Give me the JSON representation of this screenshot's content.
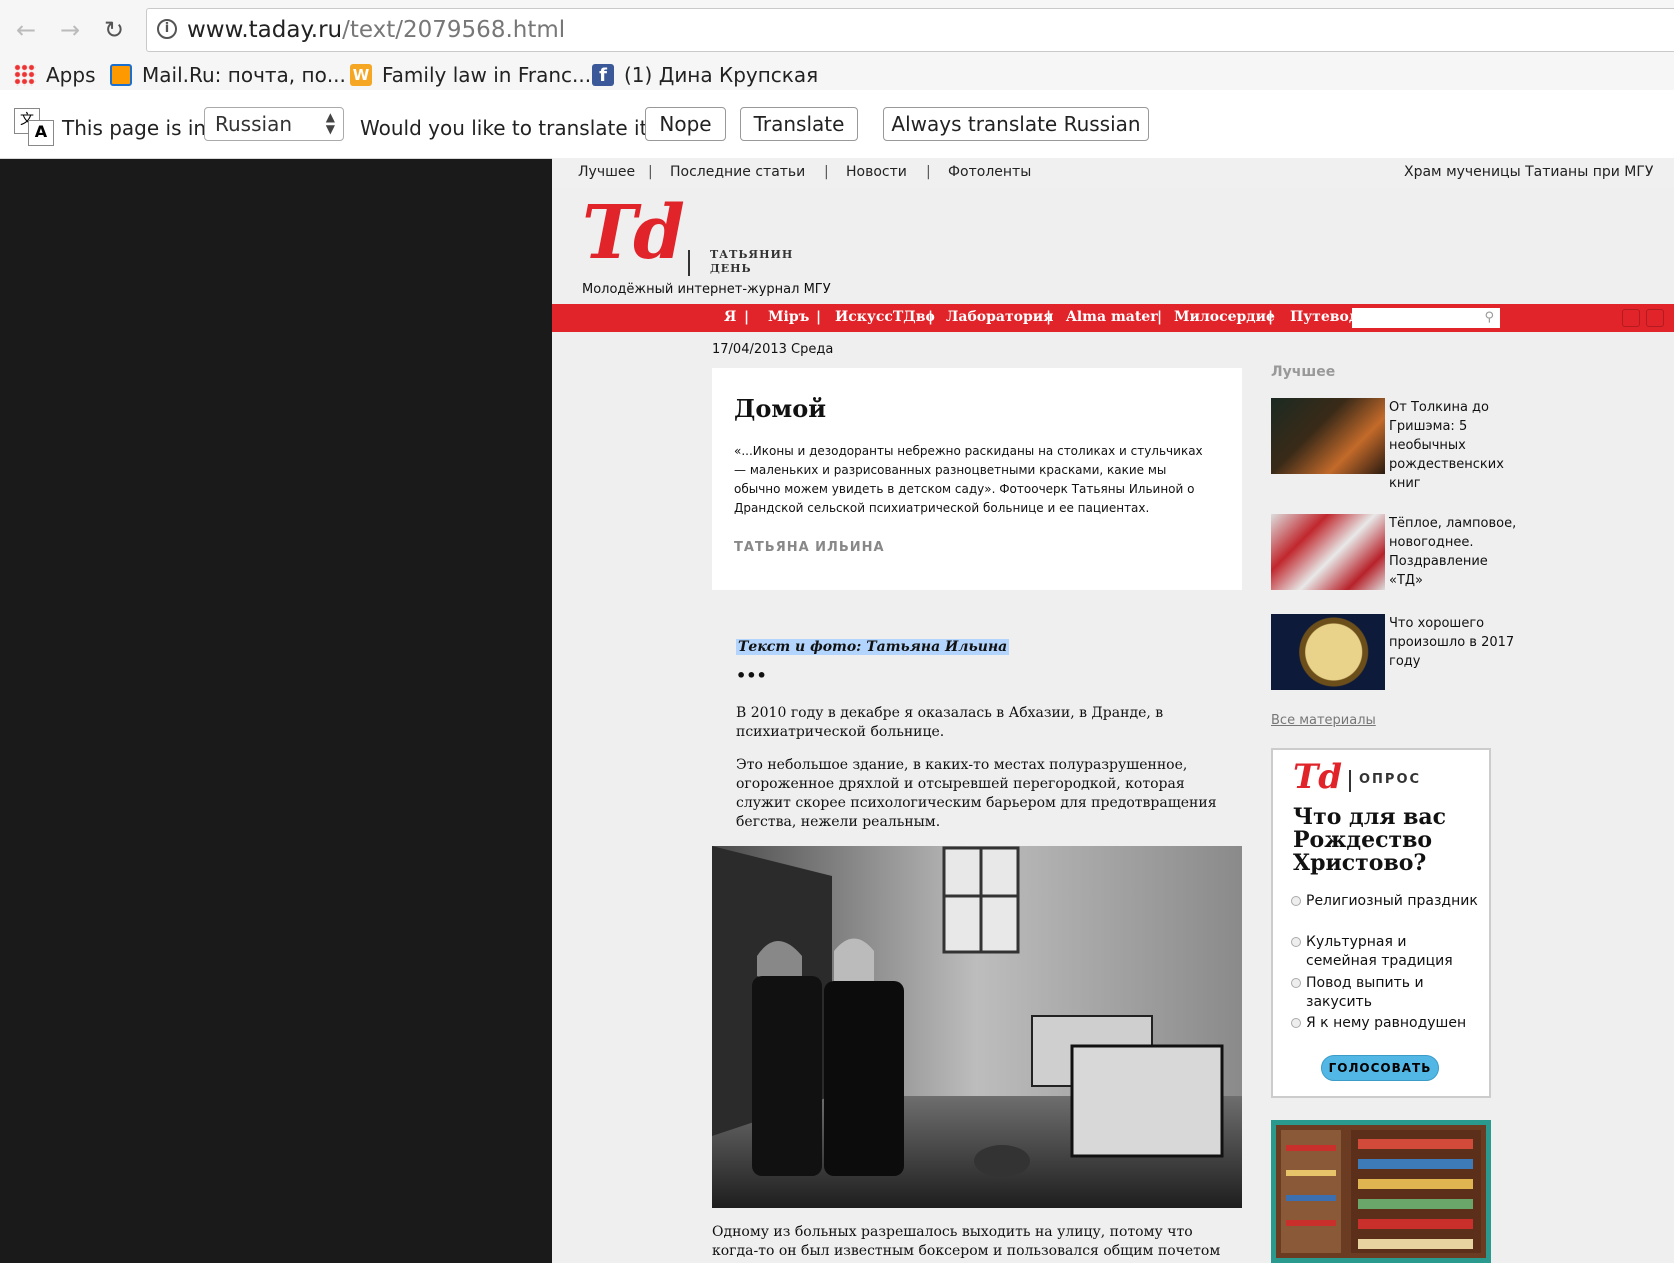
{
  "browser": {
    "url_host": "www.taday.ru",
    "url_path": "/text/2079568.html",
    "bookmarks": [
      {
        "label": "Apps"
      },
      {
        "label": "Mail.Ru: почта, по..."
      },
      {
        "label": "Family law in Franc..."
      },
      {
        "label": "(1) Дина Крупская"
      }
    ],
    "translate": {
      "page_is_in": "This page is in",
      "language": "Russian",
      "question": "Would you like to translate it?",
      "nope": "Nope",
      "translate": "Translate",
      "always": "Always translate Russian"
    }
  },
  "site": {
    "topnav": [
      "Лучшее",
      "Последние статьи",
      "Новости",
      "Фотоленты"
    ],
    "topnav_right": "Храм мученицы Татианы при МГУ",
    "logo": "Td",
    "logo_name_line1": "ТАТЬЯНИН",
    "logo_name_line2": "ДЕНЬ",
    "tagline": "Молодёжный интернет-журнал МГУ",
    "mainnav": [
      "Я",
      "Міръ",
      "ИскуссТДво",
      "Лаборатория",
      "Alma mater",
      "Милосердие",
      "Путеводи"
    ]
  },
  "article": {
    "date": "17/04/2013 Среда",
    "title": "Домой",
    "lead": "«...Иконы и дезодоранты небрежно раскиданы на столиках и стульчиках — маленьких и разрисованных разноцветными красками, какие мы обычно можем увидеть в детском саду». Фотоочерк Татьяны Ильиной о Драндской сельской психиатрической больнице и ее пациентах.",
    "author": "ТАТЬЯНА ИЛЬИНА",
    "credit": "Текст и фото: Татьяна Ильина",
    "dots": "•••",
    "para1": "В 2010 году в декабре я оказалась в Абхазии, в Дранде, в психиатрической больнице.",
    "para2": "Это небольшое здание, в каких-то местах полуразрушенное, огороженное дряхлой и отсыревшей перегородкой, которая служит скорее психологическим барьером для предотвращения бегства, нежели реальным.",
    "caption": "Одному из больных разрешалось выходить на улицу, потому что когда-то он был известным боксером и пользовался общим почетом и уважением."
  },
  "sidebar": {
    "best_title": "Лучшее",
    "items": [
      {
        "text": "От Толкина до Гришэма: 5 необычных рождественских книг"
      },
      {
        "text": "Тёплое, ламповое, новогоднее. Поздравление «ТД»"
      },
      {
        "text": "Что хорошего произошло в 2017 году"
      }
    ],
    "all_materials": "Все материалы",
    "poll": {
      "logo": "Td",
      "label": "ОПРОС",
      "question": "Что для вас Рождество Христово?",
      "options": [
        "Религиозный праздник",
        "Культурная и семейная традиция",
        "Повод выпить и закусить",
        "Я к нему равнодушен"
      ],
      "vote": "ГОЛОСОВАТЬ"
    }
  },
  "colors": {
    "brand_red": "#e1232a",
    "vote_blue": "#53b7e5",
    "banner_teal": "#2a9a8e"
  }
}
